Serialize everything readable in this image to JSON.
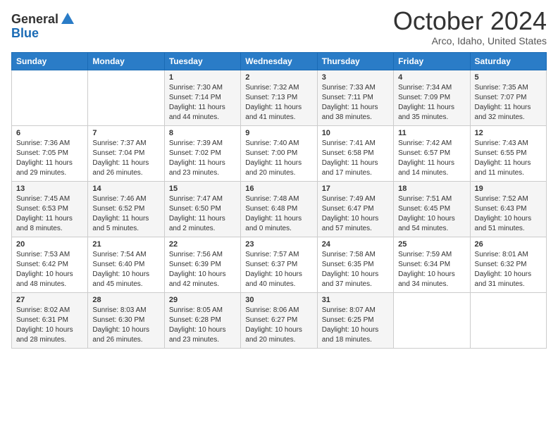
{
  "logo": {
    "general": "General",
    "blue": "Blue"
  },
  "header": {
    "month": "October 2024",
    "location": "Arco, Idaho, United States"
  },
  "days_of_week": [
    "Sunday",
    "Monday",
    "Tuesday",
    "Wednesday",
    "Thursday",
    "Friday",
    "Saturday"
  ],
  "weeks": [
    [
      {
        "day": "",
        "sunrise": "",
        "sunset": "",
        "daylight": ""
      },
      {
        "day": "",
        "sunrise": "",
        "sunset": "",
        "daylight": ""
      },
      {
        "day": "1",
        "sunrise": "Sunrise: 7:30 AM",
        "sunset": "Sunset: 7:14 PM",
        "daylight": "Daylight: 11 hours and 44 minutes."
      },
      {
        "day": "2",
        "sunrise": "Sunrise: 7:32 AM",
        "sunset": "Sunset: 7:13 PM",
        "daylight": "Daylight: 11 hours and 41 minutes."
      },
      {
        "day": "3",
        "sunrise": "Sunrise: 7:33 AM",
        "sunset": "Sunset: 7:11 PM",
        "daylight": "Daylight: 11 hours and 38 minutes."
      },
      {
        "day": "4",
        "sunrise": "Sunrise: 7:34 AM",
        "sunset": "Sunset: 7:09 PM",
        "daylight": "Daylight: 11 hours and 35 minutes."
      },
      {
        "day": "5",
        "sunrise": "Sunrise: 7:35 AM",
        "sunset": "Sunset: 7:07 PM",
        "daylight": "Daylight: 11 hours and 32 minutes."
      }
    ],
    [
      {
        "day": "6",
        "sunrise": "Sunrise: 7:36 AM",
        "sunset": "Sunset: 7:05 PM",
        "daylight": "Daylight: 11 hours and 29 minutes."
      },
      {
        "day": "7",
        "sunrise": "Sunrise: 7:37 AM",
        "sunset": "Sunset: 7:04 PM",
        "daylight": "Daylight: 11 hours and 26 minutes."
      },
      {
        "day": "8",
        "sunrise": "Sunrise: 7:39 AM",
        "sunset": "Sunset: 7:02 PM",
        "daylight": "Daylight: 11 hours and 23 minutes."
      },
      {
        "day": "9",
        "sunrise": "Sunrise: 7:40 AM",
        "sunset": "Sunset: 7:00 PM",
        "daylight": "Daylight: 11 hours and 20 minutes."
      },
      {
        "day": "10",
        "sunrise": "Sunrise: 7:41 AM",
        "sunset": "Sunset: 6:58 PM",
        "daylight": "Daylight: 11 hours and 17 minutes."
      },
      {
        "day": "11",
        "sunrise": "Sunrise: 7:42 AM",
        "sunset": "Sunset: 6:57 PM",
        "daylight": "Daylight: 11 hours and 14 minutes."
      },
      {
        "day": "12",
        "sunrise": "Sunrise: 7:43 AM",
        "sunset": "Sunset: 6:55 PM",
        "daylight": "Daylight: 11 hours and 11 minutes."
      }
    ],
    [
      {
        "day": "13",
        "sunrise": "Sunrise: 7:45 AM",
        "sunset": "Sunset: 6:53 PM",
        "daylight": "Daylight: 11 hours and 8 minutes."
      },
      {
        "day": "14",
        "sunrise": "Sunrise: 7:46 AM",
        "sunset": "Sunset: 6:52 PM",
        "daylight": "Daylight: 11 hours and 5 minutes."
      },
      {
        "day": "15",
        "sunrise": "Sunrise: 7:47 AM",
        "sunset": "Sunset: 6:50 PM",
        "daylight": "Daylight: 11 hours and 2 minutes."
      },
      {
        "day": "16",
        "sunrise": "Sunrise: 7:48 AM",
        "sunset": "Sunset: 6:48 PM",
        "daylight": "Daylight: 11 hours and 0 minutes."
      },
      {
        "day": "17",
        "sunrise": "Sunrise: 7:49 AM",
        "sunset": "Sunset: 6:47 PM",
        "daylight": "Daylight: 10 hours and 57 minutes."
      },
      {
        "day": "18",
        "sunrise": "Sunrise: 7:51 AM",
        "sunset": "Sunset: 6:45 PM",
        "daylight": "Daylight: 10 hours and 54 minutes."
      },
      {
        "day": "19",
        "sunrise": "Sunrise: 7:52 AM",
        "sunset": "Sunset: 6:43 PM",
        "daylight": "Daylight: 10 hours and 51 minutes."
      }
    ],
    [
      {
        "day": "20",
        "sunrise": "Sunrise: 7:53 AM",
        "sunset": "Sunset: 6:42 PM",
        "daylight": "Daylight: 10 hours and 48 minutes."
      },
      {
        "day": "21",
        "sunrise": "Sunrise: 7:54 AM",
        "sunset": "Sunset: 6:40 PM",
        "daylight": "Daylight: 10 hours and 45 minutes."
      },
      {
        "day": "22",
        "sunrise": "Sunrise: 7:56 AM",
        "sunset": "Sunset: 6:39 PM",
        "daylight": "Daylight: 10 hours and 42 minutes."
      },
      {
        "day": "23",
        "sunrise": "Sunrise: 7:57 AM",
        "sunset": "Sunset: 6:37 PM",
        "daylight": "Daylight: 10 hours and 40 minutes."
      },
      {
        "day": "24",
        "sunrise": "Sunrise: 7:58 AM",
        "sunset": "Sunset: 6:35 PM",
        "daylight": "Daylight: 10 hours and 37 minutes."
      },
      {
        "day": "25",
        "sunrise": "Sunrise: 7:59 AM",
        "sunset": "Sunset: 6:34 PM",
        "daylight": "Daylight: 10 hours and 34 minutes."
      },
      {
        "day": "26",
        "sunrise": "Sunrise: 8:01 AM",
        "sunset": "Sunset: 6:32 PM",
        "daylight": "Daylight: 10 hours and 31 minutes."
      }
    ],
    [
      {
        "day": "27",
        "sunrise": "Sunrise: 8:02 AM",
        "sunset": "Sunset: 6:31 PM",
        "daylight": "Daylight: 10 hours and 28 minutes."
      },
      {
        "day": "28",
        "sunrise": "Sunrise: 8:03 AM",
        "sunset": "Sunset: 6:30 PM",
        "daylight": "Daylight: 10 hours and 26 minutes."
      },
      {
        "day": "29",
        "sunrise": "Sunrise: 8:05 AM",
        "sunset": "Sunset: 6:28 PM",
        "daylight": "Daylight: 10 hours and 23 minutes."
      },
      {
        "day": "30",
        "sunrise": "Sunrise: 8:06 AM",
        "sunset": "Sunset: 6:27 PM",
        "daylight": "Daylight: 10 hours and 20 minutes."
      },
      {
        "day": "31",
        "sunrise": "Sunrise: 8:07 AM",
        "sunset": "Sunset: 6:25 PM",
        "daylight": "Daylight: 10 hours and 18 minutes."
      },
      {
        "day": "",
        "sunrise": "",
        "sunset": "",
        "daylight": ""
      },
      {
        "day": "",
        "sunrise": "",
        "sunset": "",
        "daylight": ""
      }
    ]
  ]
}
